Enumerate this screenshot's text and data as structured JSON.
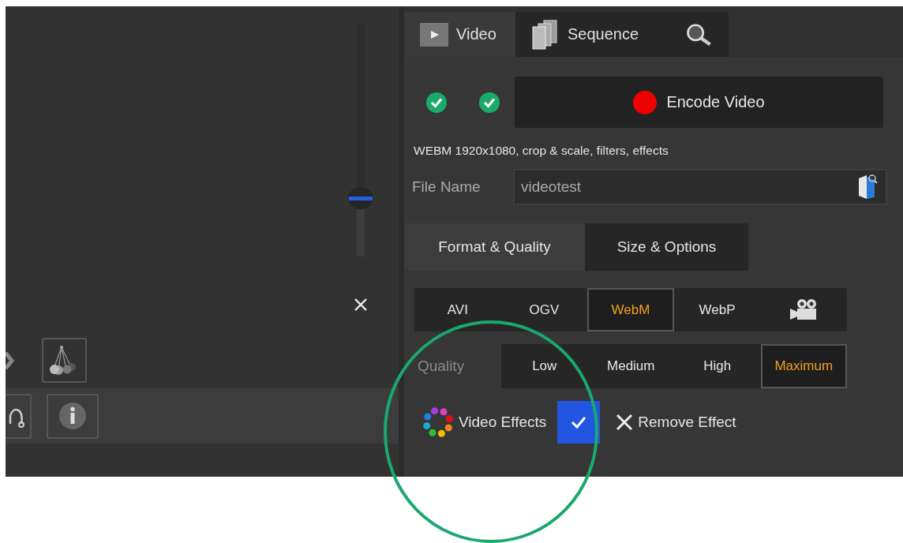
{
  "left_panel": {
    "slider": {
      "level": 0.25
    }
  },
  "main_tabs": [
    {
      "kind": "video",
      "label": "Video",
      "selected": true
    },
    {
      "kind": "sequence",
      "label": "Sequence",
      "selected": false
    },
    {
      "kind": "search",
      "selected": false
    }
  ],
  "status_checks": [
    {
      "on": true
    },
    {
      "on": true
    }
  ],
  "encode_button": {
    "label": "Encode Video"
  },
  "summary": "WEBM 1920x1080, crop & scale, filters, effects",
  "file_name": {
    "label": "File Name",
    "value": "videotest"
  },
  "sub_tabs": [
    {
      "label": "Format & Quality",
      "selected": true
    },
    {
      "label": "Size & Options",
      "selected": false
    }
  ],
  "formats": [
    {
      "kind": "text",
      "label": "AVI",
      "selected": false
    },
    {
      "kind": "text",
      "label": "OGV",
      "selected": false
    },
    {
      "kind": "text",
      "label": "WebM",
      "selected": true
    },
    {
      "kind": "text",
      "label": "WebP",
      "selected": false
    },
    {
      "kind": "camera",
      "selected": false
    }
  ],
  "quality": {
    "label": "Quality",
    "options": [
      {
        "label": "Low",
        "selected": false
      },
      {
        "label": "Medium",
        "selected": false
      },
      {
        "label": "High",
        "selected": false
      },
      {
        "label": "Maximum",
        "selected": true
      }
    ]
  },
  "effects": {
    "label": "Video Effects",
    "checked": true,
    "remove_label": "Remove Effect"
  }
}
